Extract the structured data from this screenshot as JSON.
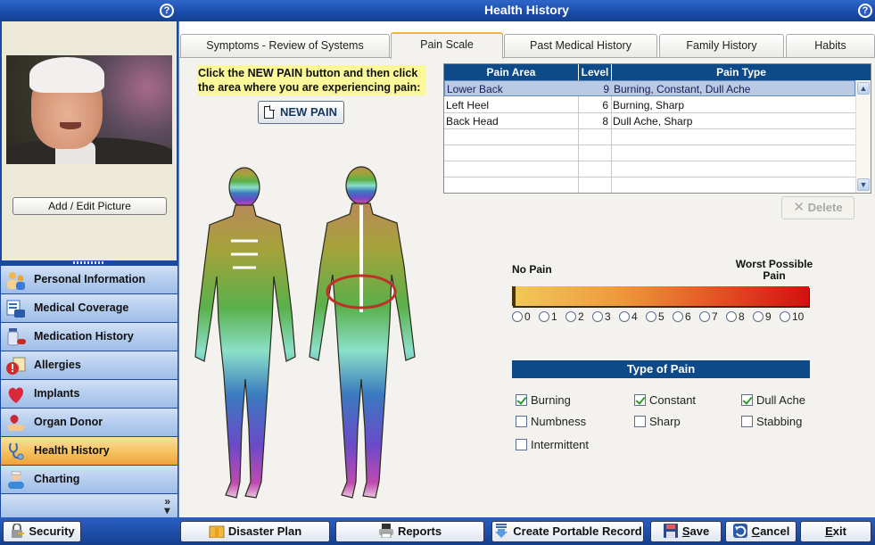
{
  "window": {
    "title": "Health History",
    "help_icon": "help-icon"
  },
  "profile": {
    "add_edit_picture_label": "Add / Edit Picture"
  },
  "sidebar": {
    "items": [
      {
        "label": "Personal Information",
        "icon": "people-icon",
        "active": false
      },
      {
        "label": "Medical Coverage",
        "icon": "insurance-card-icon",
        "active": false
      },
      {
        "label": "Medication History",
        "icon": "medicine-bottle-icon",
        "active": false
      },
      {
        "label": "Allergies",
        "icon": "allergy-warning-icon",
        "active": false
      },
      {
        "label": "Implants",
        "icon": "heart-icon",
        "active": false
      },
      {
        "label": "Organ Donor",
        "icon": "organ-hand-icon",
        "active": false
      },
      {
        "label": "Health History",
        "icon": "stethoscope-icon",
        "active": true
      },
      {
        "label": "Charting",
        "icon": "doctor-icon",
        "active": false
      }
    ],
    "more_icon": "chevron-double-down-icon"
  },
  "tabs": [
    {
      "label": "Symptoms - Review of Systems",
      "active": false
    },
    {
      "label": "Pain Scale",
      "active": true
    },
    {
      "label": "Past Medical History",
      "active": false
    },
    {
      "label": "Family History",
      "active": false
    },
    {
      "label": "Habits",
      "active": false
    }
  ],
  "pain_scale": {
    "instructions": "Click the NEW PAIN button and then click the area where you are experiencing pain:",
    "new_pain_label": "NEW PAIN",
    "table": {
      "columns": [
        "Pain Area",
        "Level",
        "Pain Type"
      ],
      "rows": [
        {
          "area": "Lower Back",
          "level": "9",
          "type": "Burning, Constant, Dull Ache",
          "selected": true
        },
        {
          "area": "Left Heel",
          "level": "6",
          "type": "Burning, Sharp",
          "selected": false
        },
        {
          "area": "Back Head",
          "level": "8",
          "type": "Dull Ache, Sharp",
          "selected": false
        }
      ],
      "empty_rows": 4
    },
    "delete_label": "Delete",
    "scale": {
      "min_label": "No Pain",
      "max_label": "Worst Possible Pain",
      "options": [
        "0",
        "1",
        "2",
        "3",
        "4",
        "5",
        "6",
        "7",
        "8",
        "9",
        "10"
      ],
      "selected": null,
      "gradient_colors": [
        "#f0c858",
        "#ef9a3a",
        "#e55a28",
        "#d41010"
      ]
    },
    "type_of_pain": {
      "title": "Type of Pain",
      "options": [
        {
          "label": "Burning",
          "checked": true
        },
        {
          "label": "Constant",
          "checked": true
        },
        {
          "label": "Dull Ache",
          "checked": true
        },
        {
          "label": "Numbness",
          "checked": false
        },
        {
          "label": "Sharp",
          "checked": false
        },
        {
          "label": "Stabbing",
          "checked": false
        },
        {
          "label": "Intermittent",
          "checked": false
        }
      ]
    },
    "marker": {
      "region": "Lower Back",
      "color": "#c0302a"
    }
  },
  "bottom_bar": {
    "security": "Security",
    "disaster_plan": "Disaster Plan",
    "reports": "Reports",
    "create_portable_record": "Create Portable Record",
    "save_prefix": "S",
    "save_rest": "ave",
    "cancel_prefix": "C",
    "cancel_rest": "ancel",
    "exit_prefix": "E",
    "exit_rest": "xit"
  },
  "colors": {
    "header_blue": "#0e4a87",
    "active_nav": "#f6c15e",
    "title_bar": "#1a4ba8",
    "instruction_highlight": "#fbf89a"
  }
}
